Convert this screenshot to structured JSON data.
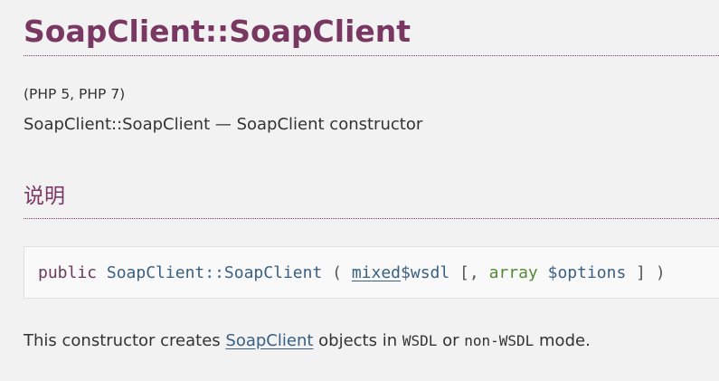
{
  "page_title": "SoapClient::SoapClient",
  "version_info": "(PHP 5, PHP 7)",
  "purpose": "SoapClient::SoapClient — SoapClient constructor",
  "section_description": "说明",
  "synopsis": {
    "modifier": "public",
    "method": "SoapClient::SoapClient",
    "open_paren": "(",
    "param1_type": "mixed",
    "param1_name": "$wsdl",
    "optional_open": "[,",
    "param2_type": "array",
    "param2_name": "$options",
    "optional_close": "]",
    "close_paren": ")"
  },
  "description": {
    "before_link": "This constructor creates ",
    "link": "SoapClient",
    "after_link": " objects in ",
    "literal1": "WSDL",
    "middle": " or ",
    "literal2": "non-WSDL",
    "end": " mode."
  },
  "colors": {
    "heading": "#793862",
    "link": "#396083",
    "type_array": "#528a35",
    "background": "#f2f2f2"
  }
}
